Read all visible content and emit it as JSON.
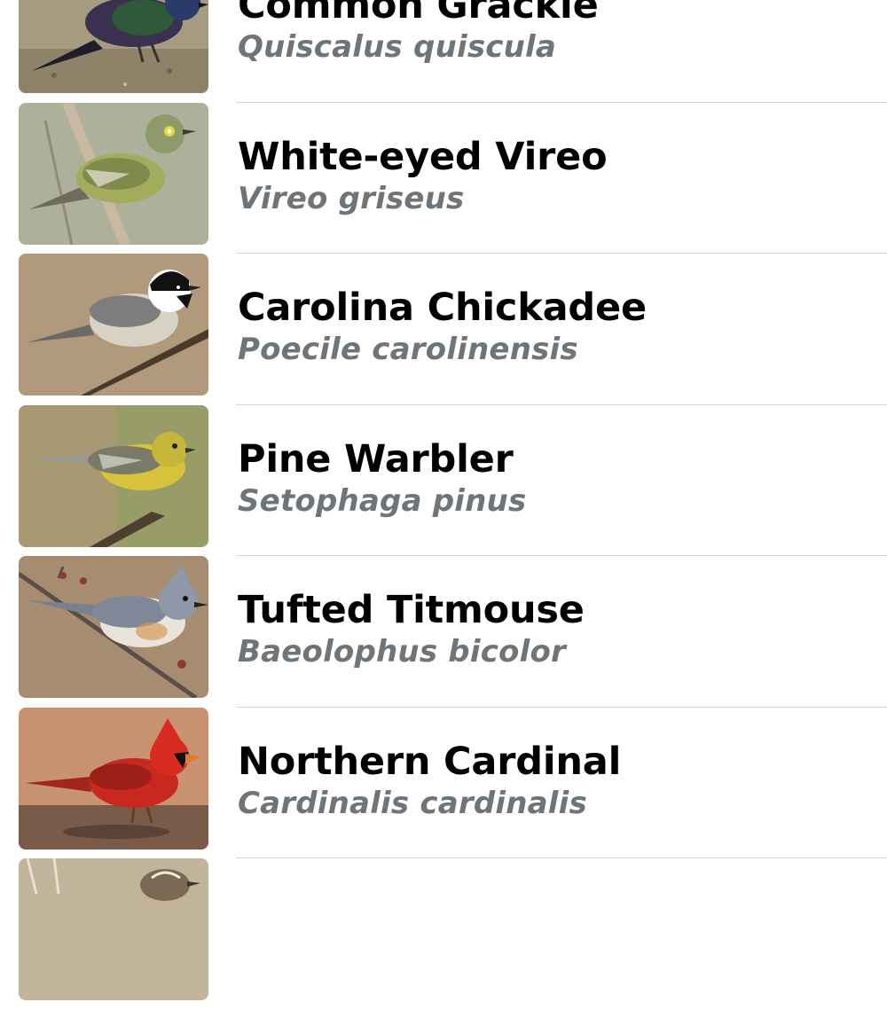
{
  "birds": [
    {
      "common_name": "Common Grackle",
      "scientific_name": "Quiscalus quiscula",
      "photo_icon": "common-grackle-photo"
    },
    {
      "common_name": "White-eyed Vireo",
      "scientific_name": "Vireo griseus",
      "photo_icon": "white-eyed-vireo-photo"
    },
    {
      "common_name": "Carolina Chickadee",
      "scientific_name": "Poecile carolinensis",
      "photo_icon": "carolina-chickadee-photo"
    },
    {
      "common_name": "Pine Warbler",
      "scientific_name": "Setophaga pinus",
      "photo_icon": "pine-warbler-photo"
    },
    {
      "common_name": "Tufted Titmouse",
      "scientific_name": "Baeolophus bicolor",
      "photo_icon": "tufted-titmouse-photo"
    },
    {
      "common_name": "Northern Cardinal",
      "scientific_name": "Cardinalis cardinalis",
      "photo_icon": "northern-cardinal-photo"
    },
    {
      "common_name": "",
      "scientific_name": "",
      "photo_icon": "partial-bird-photo"
    }
  ],
  "colors": {
    "primary_text": "#000000",
    "secondary_text": "#6f7479",
    "separator": "#d5d5d8",
    "background": "#ffffff"
  }
}
